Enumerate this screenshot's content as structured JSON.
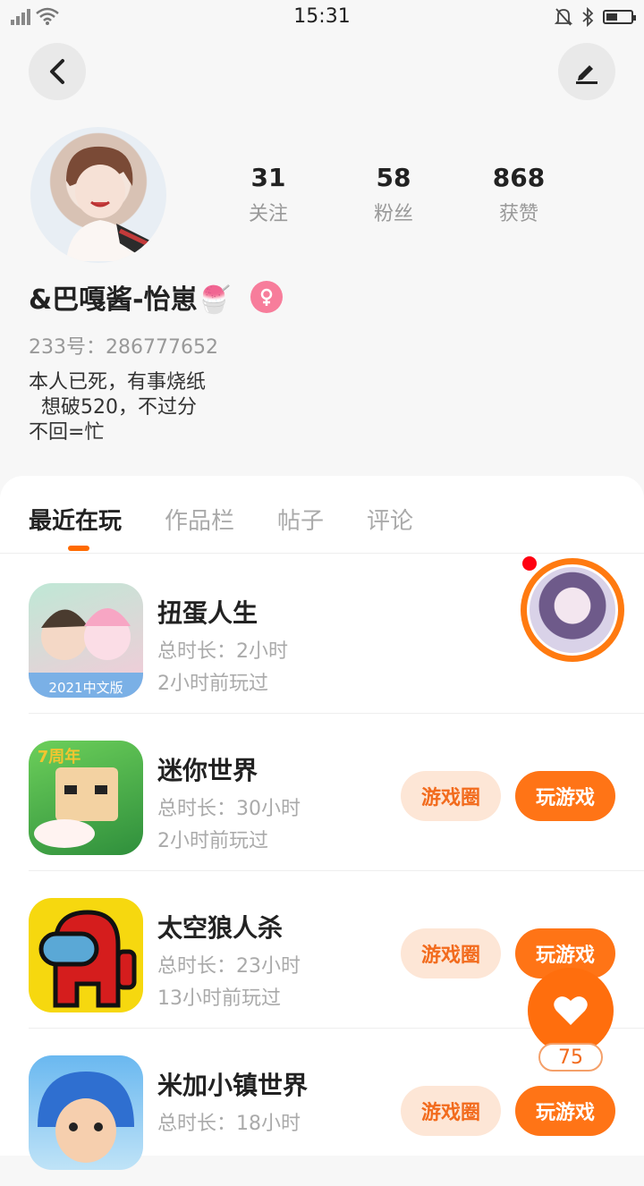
{
  "status_bar": {
    "time": "15:31"
  },
  "profile": {
    "stats": [
      {
        "num": "31",
        "label": "关注"
      },
      {
        "num": "58",
        "label": "粉丝"
      },
      {
        "num": "868",
        "label": "获赞"
      }
    ],
    "username": "&巴嘎酱-怡崽🍧",
    "uid": "233号：286777652",
    "bio": "本人已死，有事烧纸\n  想破520，不过分\n不回=忙"
  },
  "tabs": [
    "最近在玩",
    "作品栏",
    "帖子",
    "评论"
  ],
  "games": [
    {
      "name": "扭蛋人生",
      "duration": "总时长：2小时",
      "last_played": "2小时前玩过",
      "icon_label": "2021中文版"
    },
    {
      "name": "迷你世界",
      "duration": "总时长：30小时",
      "last_played": "2小时前玩过",
      "icon_label": "7周年",
      "circle_btn": "游戏圈",
      "play_btn": "玩游戏"
    },
    {
      "name": "太空狼人杀",
      "duration": "总时长：23小时",
      "last_played": "13小时前玩过",
      "circle_btn": "游戏圈",
      "play_btn": "玩游戏"
    },
    {
      "name": "米加小镇世界",
      "duration": "总时长：18小时",
      "circle_btn": "游戏圈",
      "play_btn": "玩游戏"
    }
  ],
  "like_count": "75",
  "colors": {
    "accent": "#ff7416",
    "accent_light": "#fde6d6",
    "female": "#f77d9b"
  }
}
